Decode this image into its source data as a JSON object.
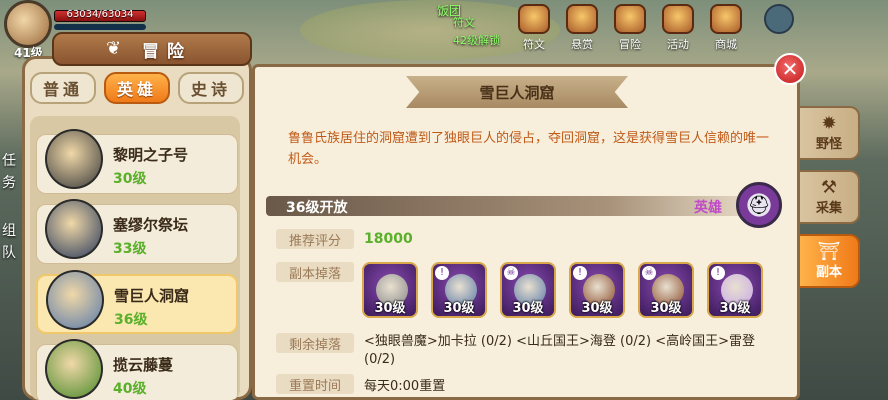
{
  "hud": {
    "hp_text": "63034/63034",
    "hp_fraction": 1.0,
    "player_level": "41级",
    "notice_line1": "饭团",
    "notice_line2": "符文",
    "unlock_note": "42级解锁",
    "menu": [
      {
        "label": "符文",
        "icon": "rune-icon"
      },
      {
        "label": "悬赏",
        "icon": "bounty-icon"
      },
      {
        "label": "冒险",
        "icon": "adventure-icon"
      },
      {
        "label": "活动",
        "icon": "event-icon"
      },
      {
        "label": "商城",
        "icon": "shop-icon"
      }
    ],
    "left_side_text": [
      "任",
      "务",
      "组",
      "队"
    ]
  },
  "left_panel": {
    "title": "冒险",
    "tabs": [
      {
        "label": "普通",
        "active": false
      },
      {
        "label": "英雄",
        "active": true
      },
      {
        "label": "史诗",
        "active": false
      }
    ],
    "dungeons": [
      {
        "name": "黎明之子号",
        "level": "30级",
        "selected": false,
        "color": "#3a3a3a"
      },
      {
        "name": "塞缪尔祭坛",
        "level": "33级",
        "selected": false,
        "color": "#2a3a5a"
      },
      {
        "name": "雪巨人洞窟",
        "level": "36级",
        "selected": true,
        "color": "#5a7aa8"
      },
      {
        "name": "揽云藤蔓",
        "level": "40级",
        "selected": false,
        "color": "#4a8a2a"
      }
    ]
  },
  "detail": {
    "title": "雪巨人洞窟",
    "description": "鲁鲁氏族居住的洞窟遭到了独眼巨人的侵占，夺回洞窟，这是获得雪巨人信赖的唯一机会。",
    "open_level": "36级开放",
    "tier": "英雄",
    "score_label": "推荐评分",
    "score_value": "18000",
    "drops_label": "副本掉落",
    "drops": [
      {
        "level": "30级",
        "kind": "ring",
        "color": "#8a8a8a"
      },
      {
        "level": "30级",
        "kind": "giant",
        "color": "#5a7aa8"
      },
      {
        "level": "30级",
        "kind": "giant",
        "color": "#5a7aa8"
      },
      {
        "level": "30级",
        "kind": "dwarf",
        "color": "#8a4a2a"
      },
      {
        "level": "30级",
        "kind": "dwarf",
        "color": "#8a4a2a"
      },
      {
        "level": "30级",
        "kind": "spirit",
        "color": "#c8a8e8"
      }
    ],
    "remain_label": "剩余掉落",
    "remain_text": "<独眼兽魔>加卡拉 (0/2)   <山丘国王>海登 (0/2)   <高岭国王>雷登 (0/2)",
    "reset_label": "重置时间",
    "reset_text": "每天0:00重置"
  },
  "side_tabs": [
    {
      "label": "野怪",
      "icon": "monster-icon",
      "active": false
    },
    {
      "label": "采集",
      "icon": "gather-icon",
      "active": false
    },
    {
      "label": "副本",
      "icon": "dungeon-icon",
      "active": true
    }
  ],
  "colors": {
    "accent": "#ef7a18",
    "level_green": "#5ab02a",
    "desc_orange": "#c05a18",
    "tier_purple": "#c04ac8"
  }
}
